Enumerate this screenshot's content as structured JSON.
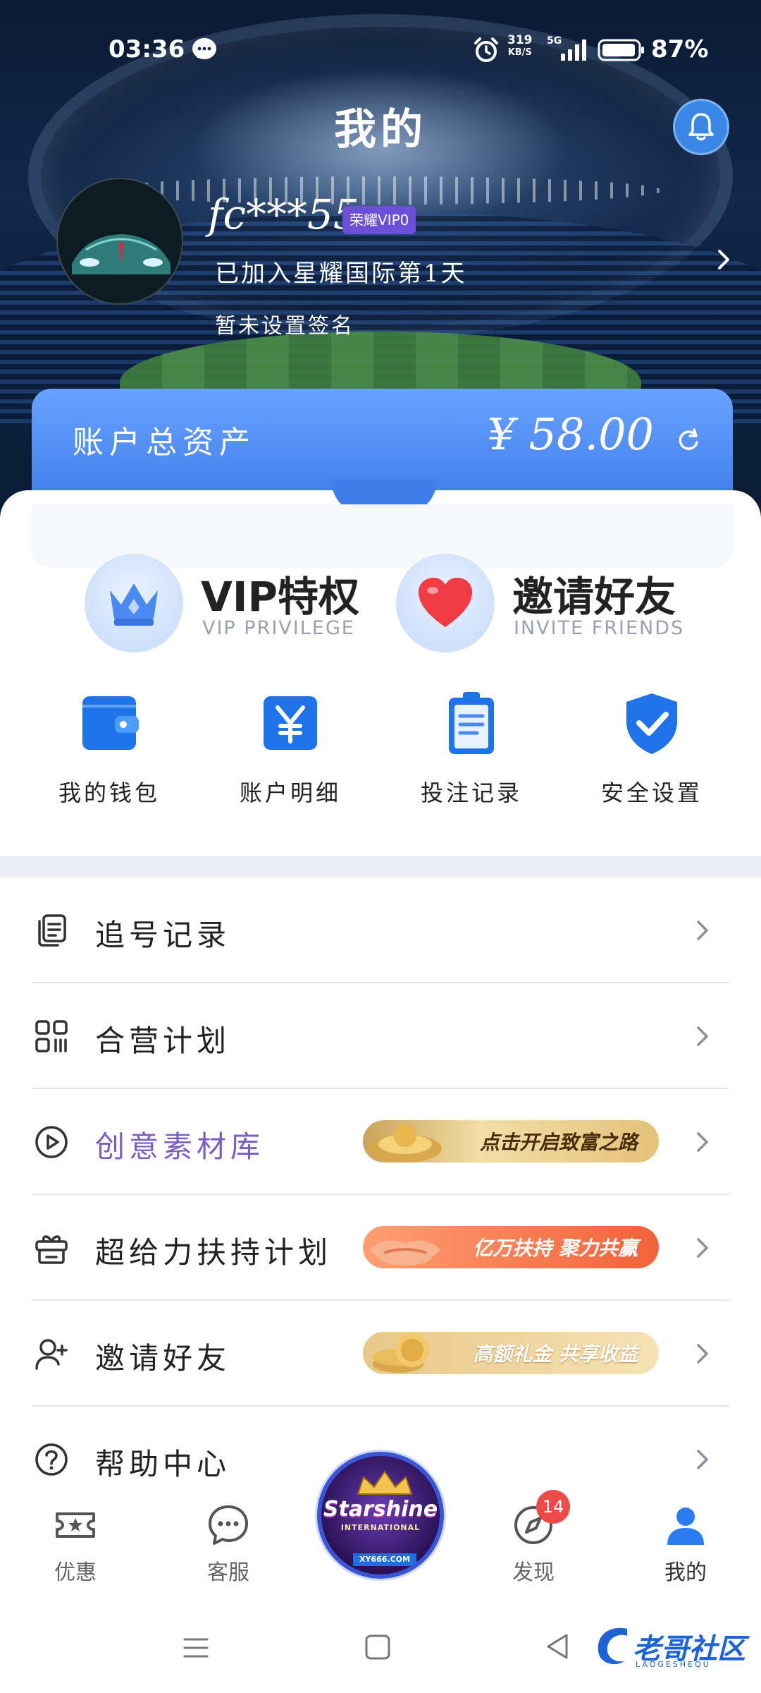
{
  "status_bar": {
    "time": "03:36",
    "net_speed_value": "319",
    "net_speed_unit": "KB/S",
    "network": "5G",
    "battery": "87%"
  },
  "header": {
    "title": "我的"
  },
  "profile": {
    "username": "fc***55",
    "vip_badge": "荣耀VIP0",
    "joined_text": "已加入星耀国际第1天",
    "signature": "暂未设置签名"
  },
  "assets": {
    "label": "账户总资产",
    "value": "¥ 58.00"
  },
  "features": [
    {
      "title": "VIP特权",
      "subtitle": "VIP PRIVILEGE"
    },
    {
      "title": "邀请好友",
      "subtitle": "INVITE FRIENDS"
    }
  ],
  "quick_actions": [
    {
      "label": "我的钱包",
      "icon": "wallet-icon"
    },
    {
      "label": "账户明细",
      "icon": "yen-icon"
    },
    {
      "label": "投注记录",
      "icon": "clipboard-icon"
    },
    {
      "label": "安全设置",
      "icon": "shield-icon"
    }
  ],
  "menu": [
    {
      "label": "追号记录",
      "icon": "copy-list-icon"
    },
    {
      "label": "合营计划",
      "icon": "grid-icon"
    },
    {
      "label": "创意素材库",
      "icon": "play-circle-icon",
      "banner": "点击开启致富之路"
    },
    {
      "label": "超给力扶持计划",
      "icon": "gift-icon",
      "banner": "亿万扶持 聚力共赢"
    },
    {
      "label": "邀请好友",
      "icon": "add-user-icon",
      "banner": "高额礼金 共享收益"
    },
    {
      "label": "帮助中心",
      "icon": "help-icon"
    }
  ],
  "tab_bar": {
    "tabs": [
      {
        "label": "优惠",
        "icon": "ticket-icon"
      },
      {
        "label": "客服",
        "icon": "chat-bubble-icon"
      },
      {
        "label": "发现",
        "icon": "compass-icon",
        "badge": "14"
      },
      {
        "label": "我的",
        "icon": "user-icon",
        "active": true
      }
    ],
    "center_logo": {
      "brand": "Starshine",
      "sub": "INTERNATIONAL",
      "domain": "XY666.COM"
    }
  },
  "watermark": {
    "text": "老哥社区",
    "sub": "LAOGESHEQU"
  },
  "colors": {
    "accent_blue": "#3f7ee9",
    "purple_label": "#7a5cc7",
    "badge_red": "#ef4a4a"
  }
}
